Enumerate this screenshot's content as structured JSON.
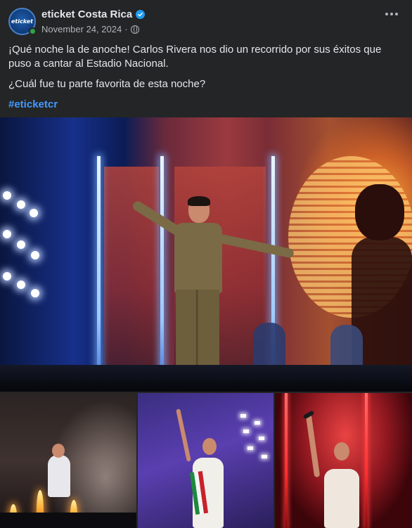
{
  "header": {
    "avatar_text": "eticket",
    "page_name": "eticket Costa Rica",
    "date": "November 24, 2024",
    "separator": "·"
  },
  "post": {
    "paragraph_1": "¡Qué noche la de anoche! Carlos Rivera nos dio un recorrido por sus éxitos que puso a cantar al Estadio Nacional.",
    "paragraph_2": "¿Cuál fue tu parte favorita de esta noche?",
    "hashtag": "#eticketcr"
  },
  "icons": {
    "verified": "verified-badge-icon",
    "privacy": "globe-icon",
    "more": "more-options-icon"
  },
  "colors": {
    "background": "#242526",
    "text": "#e4e6eb",
    "secondary_text": "#b0b3b8",
    "link": "#4599ff",
    "verified": "#1d9bf0",
    "online": "#31a24c"
  },
  "photos": {
    "count_shown": 4
  }
}
